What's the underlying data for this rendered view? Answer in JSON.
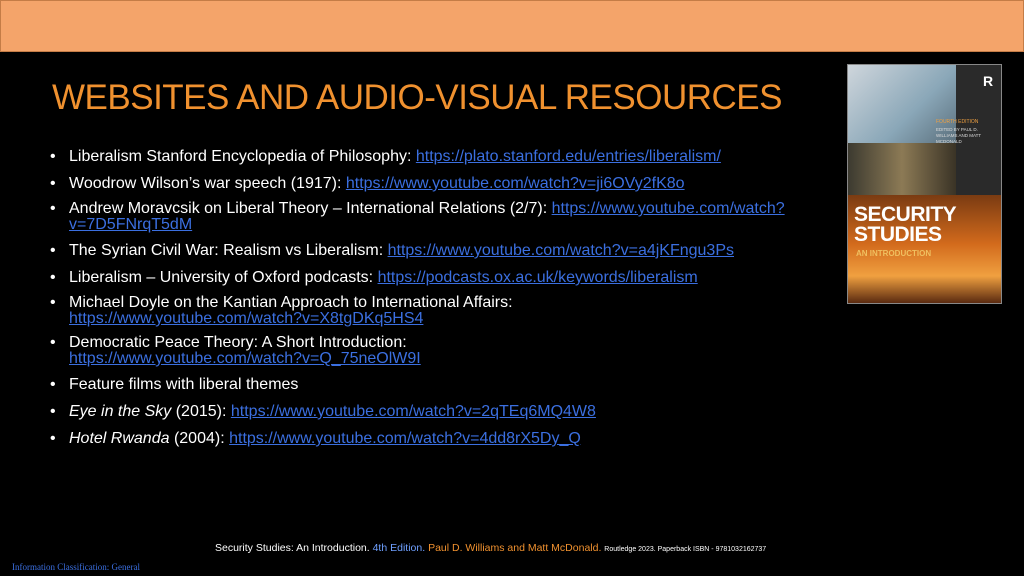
{
  "title": "WEBSITES AND AUDIO-VISUAL RESOURCES",
  "bullets": [
    {
      "text": "Liberalism Stanford Encyclopedia of Philosophy: ",
      "link": "https://plato.stanford.edu/entries/liberalism/"
    },
    {
      "text": "Woodrow Wilson’s war speech (1917): ",
      "link": "https://www.youtube.com/watch?v=ji6OVy2fK8o"
    },
    {
      "text": "Andrew Moravcsik on Liberal Theory – International Relations (2/7): ",
      "link": "https://www.youtube.com/watch?v=7D5FNrqT5dM"
    },
    {
      "text": "The Syrian Civil War: Realism vs Liberalism: ",
      "link": "https://www.youtube.com/watch?v=a4jKFngu3Ps"
    },
    {
      "text": "Liberalism – University of Oxford podcasts: ",
      "link": "https://podcasts.ox.ac.uk/keywords/liberalism"
    },
    {
      "text": "Michael Doyle on the Kantian Approach to International Affairs: ",
      "link": "https://www.youtube.com/watch?v=X8tgDKq5HS4"
    },
    {
      "text": "Democratic Peace Theory: A Short Introduction: ",
      "link": "https://www.youtube.com/watch?v=Q_75neOlW9I"
    },
    {
      "text": "Feature films with liberal themes"
    },
    {
      "italic": "Eye in the Sky",
      "text": " (2015): ",
      "link": "https://www.youtube.com/watch?v=2qTEq6MQ4W8"
    },
    {
      "italic": "Hotel Rwanda",
      "text": " (2004): ",
      "link": "https://www.youtube.com/watch?v=4dd8rX5Dy_Q"
    }
  ],
  "cover": {
    "publisher_logo": "R",
    "edition": "FOURTH EDITION",
    "editors": "EDITED BY PAUL D. WILLIAMS AND MATT MCDONALD",
    "title_line1": "SECURITY",
    "title_line2": "STUDIES",
    "subtitle": "AN INTRODUCTION"
  },
  "footer": {
    "book": "Security Studies: An Introduction.",
    "edition": "4th Edition.",
    "authors": "Paul D. Williams and Matt McDonald.",
    "publisher": "Routledge 2023. Paperback ISBN - 9781032162737"
  },
  "classification": "Information Classification: General",
  "colors": {
    "accent": "#f0912f",
    "link": "#3b6fe0",
    "top_bar": "#f4a46a",
    "background": "#000000"
  }
}
